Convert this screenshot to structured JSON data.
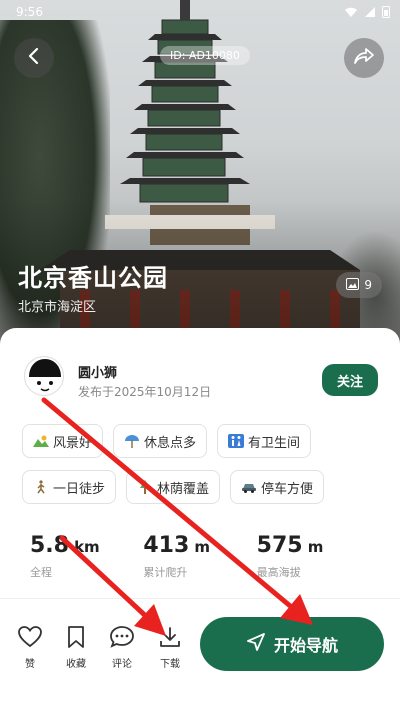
{
  "status": {
    "time": "9:56"
  },
  "hero": {
    "id_text": "ID: AD10080",
    "title": "北京香山公园",
    "subtitle": "北京市海淀区",
    "photo_count": "9"
  },
  "author": {
    "name": "圆小狮",
    "date": "发布于2025年10月12日",
    "follow_label": "关注"
  },
  "tags": [
    [
      {
        "label": "风景好",
        "icon": "landscape-icon",
        "color": "#e6a23c"
      },
      {
        "label": "休息点多",
        "icon": "beach-umbrella-icon",
        "color": "#4a90d9"
      },
      {
        "label": "有卫生间",
        "icon": "restroom-icon",
        "color": "#3a7bd5"
      }
    ],
    [
      {
        "label": "一日徒步",
        "icon": "hiker-icon",
        "color": "#8a6d3b"
      },
      {
        "label": "林荫覆盖",
        "icon": "tree-icon",
        "color": "#4caf50"
      },
      {
        "label": "停车方便",
        "icon": "car-icon",
        "color": "#607d8b"
      }
    ]
  ],
  "stats": [
    {
      "value": "5.8",
      "unit": "km",
      "label": "全程"
    },
    {
      "value": "413",
      "unit": "m",
      "label": "累计爬升"
    },
    {
      "value": "575",
      "unit": "m",
      "label": "最高海拔"
    }
  ],
  "actions": {
    "like": "赞",
    "favorite": "收藏",
    "comment": "评论",
    "download": "下载",
    "navigate": "开始导航"
  },
  "colors": {
    "accent": "#1a6e4e",
    "annotation_arrow": "#e8231f"
  }
}
